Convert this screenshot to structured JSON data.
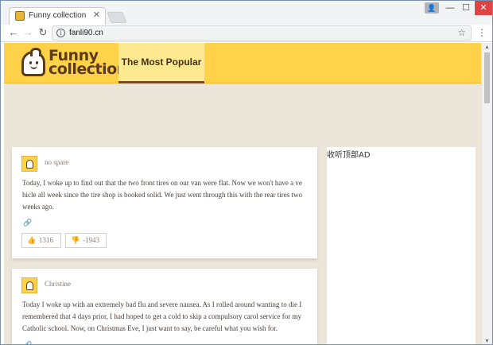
{
  "browser": {
    "tab_title": "Funny collection",
    "tab_close": "✕",
    "url": "fanli90.cn",
    "icons": [
      "back-arrow-icon",
      "forward-arrow-icon",
      "reload-icon",
      "info-icon",
      "star-icon",
      "menu-icon",
      "user-icon",
      "minimize-icon",
      "maximize-icon",
      "close-icon"
    ]
  },
  "site": {
    "logo_line1": "Funny",
    "logo_line2": "collection",
    "nav_active": "The Most Popular",
    "accent_color": "#ffd24a",
    "brand_brown": "#5a3b1a"
  },
  "posts": [
    {
      "username": "no spare",
      "text": "Today, I woke up to find out that the two front tires on our van were flat. Now we won't have a vehicle all week since the tire shop is booked solid. We just went through this with the rear tires two weeks ago.",
      "up_votes": "1316",
      "down_votes": "-1943"
    },
    {
      "username": "Christine",
      "text": "Today I woke up with an extremely bad flu and severe nausea. As I rolled around wanting to die I remembered that 4 days prior, I had hoped to get a cold to skip a compulsory carol service for my Catholic school. Now, on Christmas Eve, I just want to say, be careful what you wish for."
    }
  ],
  "sidebar": {
    "title": "收听顶部AD"
  }
}
